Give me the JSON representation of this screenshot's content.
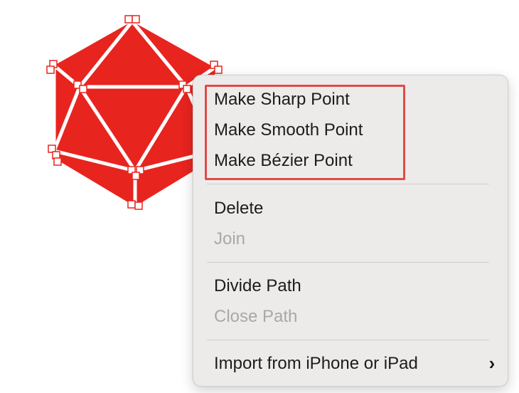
{
  "canvas": {
    "shape_color": "#e8241f",
    "edge_color": "#ffffff",
    "handle_color": "#e8241f",
    "shape_name": "icosahedron-path"
  },
  "context_menu": {
    "groups": [
      {
        "items": [
          {
            "label": "Make Sharp Point",
            "enabled": true
          },
          {
            "label": "Make Smooth Point",
            "enabled": true
          },
          {
            "label": "Make Bézier Point",
            "enabled": true
          }
        ]
      },
      {
        "items": [
          {
            "label": "Delete",
            "enabled": true
          },
          {
            "label": "Join",
            "enabled": false
          }
        ]
      },
      {
        "items": [
          {
            "label": "Divide Path",
            "enabled": true
          },
          {
            "label": "Close Path",
            "enabled": false
          }
        ]
      },
      {
        "items": [
          {
            "label": "Import from iPhone or iPad",
            "enabled": true,
            "submenu": true,
            "arrow": "›"
          }
        ]
      }
    ],
    "highlight_color": "#e04a4a"
  }
}
